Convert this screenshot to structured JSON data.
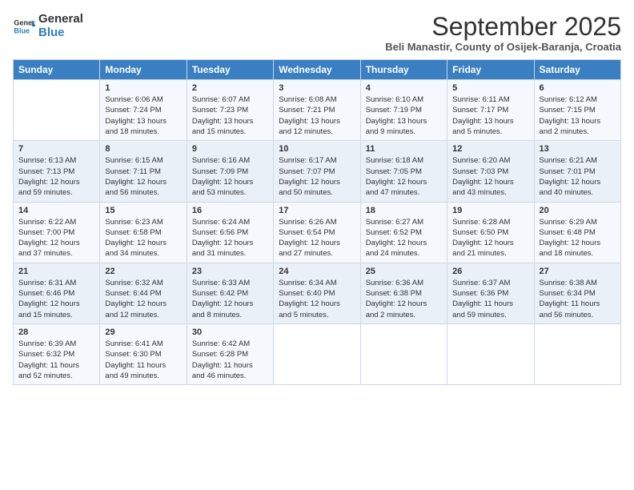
{
  "logo": {
    "text_general": "General",
    "text_blue": "Blue"
  },
  "header": {
    "month": "September 2025",
    "location": "Beli Manastir, County of Osijek-Baranja, Croatia"
  },
  "days_of_week": [
    "Sunday",
    "Monday",
    "Tuesday",
    "Wednesday",
    "Thursday",
    "Friday",
    "Saturday"
  ],
  "weeks": [
    [
      {
        "day": "",
        "info": ""
      },
      {
        "day": "1",
        "info": "Sunrise: 6:06 AM\nSunset: 7:24 PM\nDaylight: 13 hours\nand 18 minutes."
      },
      {
        "day": "2",
        "info": "Sunrise: 6:07 AM\nSunset: 7:23 PM\nDaylight: 13 hours\nand 15 minutes."
      },
      {
        "day": "3",
        "info": "Sunrise: 6:08 AM\nSunset: 7:21 PM\nDaylight: 13 hours\nand 12 minutes."
      },
      {
        "day": "4",
        "info": "Sunrise: 6:10 AM\nSunset: 7:19 PM\nDaylight: 13 hours\nand 9 minutes."
      },
      {
        "day": "5",
        "info": "Sunrise: 6:11 AM\nSunset: 7:17 PM\nDaylight: 13 hours\nand 5 minutes."
      },
      {
        "day": "6",
        "info": "Sunrise: 6:12 AM\nSunset: 7:15 PM\nDaylight: 13 hours\nand 2 minutes."
      }
    ],
    [
      {
        "day": "7",
        "info": "Sunrise: 6:13 AM\nSunset: 7:13 PM\nDaylight: 12 hours\nand 59 minutes."
      },
      {
        "day": "8",
        "info": "Sunrise: 6:15 AM\nSunset: 7:11 PM\nDaylight: 12 hours\nand 56 minutes."
      },
      {
        "day": "9",
        "info": "Sunrise: 6:16 AM\nSunset: 7:09 PM\nDaylight: 12 hours\nand 53 minutes."
      },
      {
        "day": "10",
        "info": "Sunrise: 6:17 AM\nSunset: 7:07 PM\nDaylight: 12 hours\nand 50 minutes."
      },
      {
        "day": "11",
        "info": "Sunrise: 6:18 AM\nSunset: 7:05 PM\nDaylight: 12 hours\nand 47 minutes."
      },
      {
        "day": "12",
        "info": "Sunrise: 6:20 AM\nSunset: 7:03 PM\nDaylight: 12 hours\nand 43 minutes."
      },
      {
        "day": "13",
        "info": "Sunrise: 6:21 AM\nSunset: 7:01 PM\nDaylight: 12 hours\nand 40 minutes."
      }
    ],
    [
      {
        "day": "14",
        "info": "Sunrise: 6:22 AM\nSunset: 7:00 PM\nDaylight: 12 hours\nand 37 minutes."
      },
      {
        "day": "15",
        "info": "Sunrise: 6:23 AM\nSunset: 6:58 PM\nDaylight: 12 hours\nand 34 minutes."
      },
      {
        "day": "16",
        "info": "Sunrise: 6:24 AM\nSunset: 6:56 PM\nDaylight: 12 hours\nand 31 minutes."
      },
      {
        "day": "17",
        "info": "Sunrise: 6:26 AM\nSunset: 6:54 PM\nDaylight: 12 hours\nand 27 minutes."
      },
      {
        "day": "18",
        "info": "Sunrise: 6:27 AM\nSunset: 6:52 PM\nDaylight: 12 hours\nand 24 minutes."
      },
      {
        "day": "19",
        "info": "Sunrise: 6:28 AM\nSunset: 6:50 PM\nDaylight: 12 hours\nand 21 minutes."
      },
      {
        "day": "20",
        "info": "Sunrise: 6:29 AM\nSunset: 6:48 PM\nDaylight: 12 hours\nand 18 minutes."
      }
    ],
    [
      {
        "day": "21",
        "info": "Sunrise: 6:31 AM\nSunset: 6:46 PM\nDaylight: 12 hours\nand 15 minutes."
      },
      {
        "day": "22",
        "info": "Sunrise: 6:32 AM\nSunset: 6:44 PM\nDaylight: 12 hours\nand 12 minutes."
      },
      {
        "day": "23",
        "info": "Sunrise: 6:33 AM\nSunset: 6:42 PM\nDaylight: 12 hours\nand 8 minutes."
      },
      {
        "day": "24",
        "info": "Sunrise: 6:34 AM\nSunset: 6:40 PM\nDaylight: 12 hours\nand 5 minutes."
      },
      {
        "day": "25",
        "info": "Sunrise: 6:36 AM\nSunset: 6:38 PM\nDaylight: 12 hours\nand 2 minutes."
      },
      {
        "day": "26",
        "info": "Sunrise: 6:37 AM\nSunset: 6:36 PM\nDaylight: 11 hours\nand 59 minutes."
      },
      {
        "day": "27",
        "info": "Sunrise: 6:38 AM\nSunset: 6:34 PM\nDaylight: 11 hours\nand 56 minutes."
      }
    ],
    [
      {
        "day": "28",
        "info": "Sunrise: 6:39 AM\nSunset: 6:32 PM\nDaylight: 11 hours\nand 52 minutes."
      },
      {
        "day": "29",
        "info": "Sunrise: 6:41 AM\nSunset: 6:30 PM\nDaylight: 11 hours\nand 49 minutes."
      },
      {
        "day": "30",
        "info": "Sunrise: 6:42 AM\nSunset: 6:28 PM\nDaylight: 11 hours\nand 46 minutes."
      },
      {
        "day": "",
        "info": ""
      },
      {
        "day": "",
        "info": ""
      },
      {
        "day": "",
        "info": ""
      },
      {
        "day": "",
        "info": ""
      }
    ]
  ]
}
